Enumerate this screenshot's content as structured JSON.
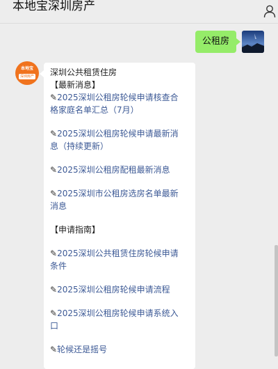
{
  "header": {
    "title": "本地宝深圳房产",
    "user_icon": "person-icon"
  },
  "outgoing": {
    "text": "公租房"
  },
  "bot": {
    "avatar_line1": "本地宝",
    "avatar_line2": "深圳房产"
  },
  "message": {
    "intro": "深圳公共租赁住房",
    "section1": "【最新消息】",
    "section2": "【申请指南】",
    "pencil": "✎",
    "links": [
      {
        "line1": "2025深圳公租房轮候申请核查合",
        "line2": "格家庭名单汇总（7月）"
      },
      {
        "line1": "2025深圳公租房轮候申请最新消",
        "line2": "息（持续更新）"
      },
      {
        "line1": "2025深圳公租房配租最新消息"
      },
      {
        "line1": "2025深圳市公租房选房名单最新",
        "line2": "消息"
      },
      {
        "line1": "2025深圳公共租赁住房轮候申请",
        "line2": "条件"
      },
      {
        "line1": "2025深圳公租房轮候申请流程"
      },
      {
        "line1": "2025深圳公租房轮候申请系统入",
        "line2": "口"
      },
      {
        "line1": "轮候还是摇号"
      }
    ]
  }
}
